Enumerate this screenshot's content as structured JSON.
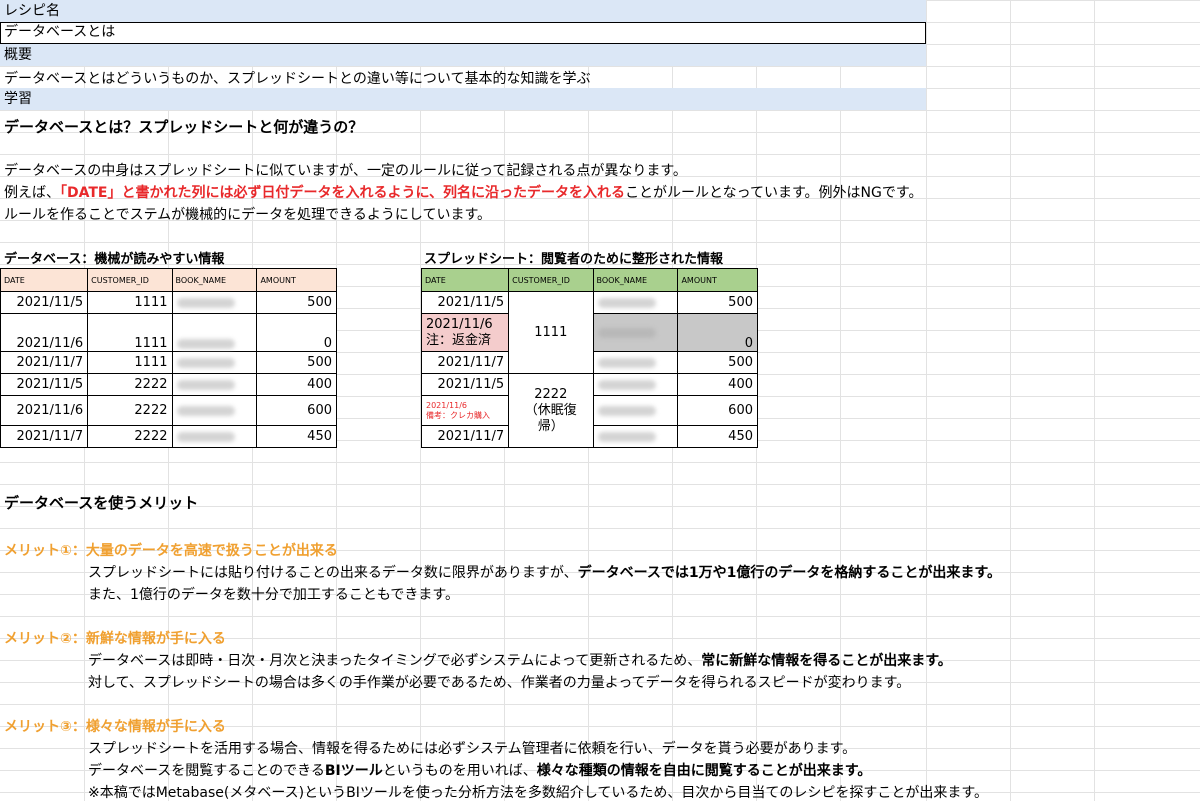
{
  "rows": {
    "recipe_label": "レシピ名",
    "recipe_value": "データベースとは",
    "summary_label": "概要",
    "summary_value": "データベースとはどういうものか、スプレッドシートとの違い等について基本的な知識を学ぶ",
    "learning_label": "学習"
  },
  "intro": {
    "heading": "データベースとは？スプレッドシートと何が違うの？",
    "line1": "データベースの中身はスプレッドシートに似ていますが、一定のルールに従って記録される点が異なります。",
    "line2_a": "例えば、",
    "line2_red": "「DATE」と書かれた列には必ず日付データを入れるように、列名に沿ったデータを入れる",
    "line2_b": "ことがルールとなっています。例外はNGです。",
    "line3": "ルールを作ることでステムが機械的にデータを処理できるようにしています。"
  },
  "db_table": {
    "title": "データベース：機械が読みやすい情報",
    "header_color": "#fce4d6",
    "headers": [
      "DATE",
      "CUSTOMER_ID",
      "BOOK_NAME",
      "AMOUNT"
    ],
    "rows": [
      {
        "date": "2021/11/5",
        "customer": "1111",
        "amount": "500"
      },
      {
        "date": "2021/11/6",
        "customer": "1111",
        "amount": "0"
      },
      {
        "date": "2021/11/7",
        "customer": "1111",
        "amount": "500"
      },
      {
        "date": "2021/11/5",
        "customer": "2222",
        "amount": "400"
      },
      {
        "date": "2021/11/6",
        "customer": "2222",
        "amount": "600"
      },
      {
        "date": "2021/11/7",
        "customer": "2222",
        "amount": "450"
      }
    ]
  },
  "sheet_table": {
    "title": "スプレッドシート：閲覧者のために整形された情報",
    "header_color": "#a9d08e",
    "headers": [
      "DATE",
      "CUSTOMER_ID",
      "BOOK_NAME",
      "AMOUNT"
    ],
    "r1_date": "2021/11/5",
    "r1_amount": "500",
    "r2_date_line1": "2021/11/6",
    "r2_date_line2": "注：返金済",
    "r2_amount": "0",
    "r3_date": "2021/11/7",
    "r3_amount": "500",
    "cust1": "1111",
    "r4_date": "2021/11/5",
    "r4_amount": "400",
    "r5_note_line1": "2021/11/6",
    "r5_note_line2": "備考：クレカ購入",
    "r5_amount": "600",
    "r6_date": "2021/11/7",
    "r6_amount": "450",
    "cust2_line1": "2222",
    "cust2_line2": "（休眠復",
    "cust2_line3": "帰）"
  },
  "merits": {
    "heading": "データベースを使うメリット",
    "m1_title": "メリット①：大量のデータを高速で扱うことが出来る",
    "m1_line1_a": "スプレッドシートには貼り付けることの出来るデータ数に限界がありますが、",
    "m1_line1_b": "データベースでは1万や1億行のデータを格納することが出来ます。",
    "m1_line2": "また、1億行のデータを数十分で加工することもできます。",
    "m2_title": "メリット②：新鮮な情報が手に入る",
    "m2_line1_a": "データベースは即時・日次・月次と決まったタイミングで必ずシステムによって更新されるため、",
    "m2_line1_b": "常に新鮮な情報を得ることが出来ます。",
    "m2_line2": "対して、スプレッドシートの場合は多くの手作業が必要であるため、作業者の力量よってデータを得られるスピードが変わります。",
    "m3_title": "メリット③：様々な情報が手に入る",
    "m3_line1": "スプレッドシートを活用する場合、情報を得るためには必ずシステム管理者に依頼を行い、データを貰う必要があります。",
    "m3_line2_a": "データベースを閲覧することのできる",
    "m3_line2_b": "BIツール",
    "m3_line2_c": "というものを用いれば、",
    "m3_line2_d": "様々な種類の情報を自由に閲覧することが出来ます。",
    "m3_line3": "※本稿ではMetabase(メタベース)というBIツールを使った分析方法を多数紹介しているため、目次から目当てのレシピを探すことが出来ます。"
  },
  "colors": {
    "label_bg": "#dbe7f6",
    "accent_red": "#e8292b",
    "accent_orange": "#f0a030"
  }
}
